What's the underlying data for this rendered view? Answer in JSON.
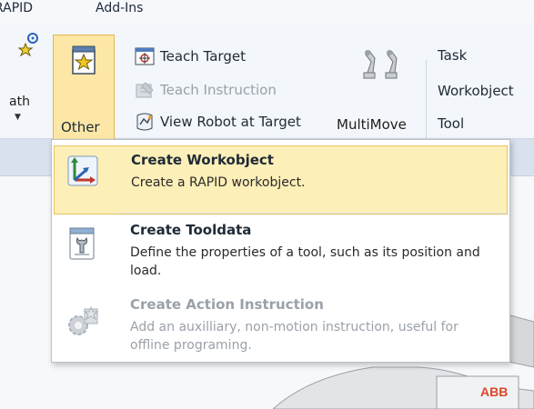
{
  "tabs": [
    "RAPID",
    "Add-Ins"
  ],
  "ribbon": {
    "path_label": "ath",
    "other_label": "Other",
    "teach_target": "Teach Target",
    "teach_instruction": "Teach Instruction",
    "view_robot": "View Robot at Target",
    "multimove": "MultiMove",
    "task": "Task",
    "workobject": "Workobject",
    "tool": "Tool"
  },
  "menu": {
    "items": [
      {
        "title": "Create Workobject",
        "desc": "Create a RAPID workobject.",
        "icon": "workobject-axes-icon",
        "state": "highlighted"
      },
      {
        "title": "Create Tooldata",
        "desc": "Define the properties of a tool, such as its position and load.",
        "icon": "tooldata-icon",
        "state": "normal"
      },
      {
        "title": "Create Action Instruction",
        "desc": "Add an auxilliary, non-motion instruction, useful for offline programing.",
        "icon": "action-instruction-icon",
        "state": "disabled"
      }
    ]
  },
  "colors": {
    "highlight": "#fdefb8",
    "highlight_border": "#e6c460",
    "disabled_text": "#9aa1a9"
  }
}
